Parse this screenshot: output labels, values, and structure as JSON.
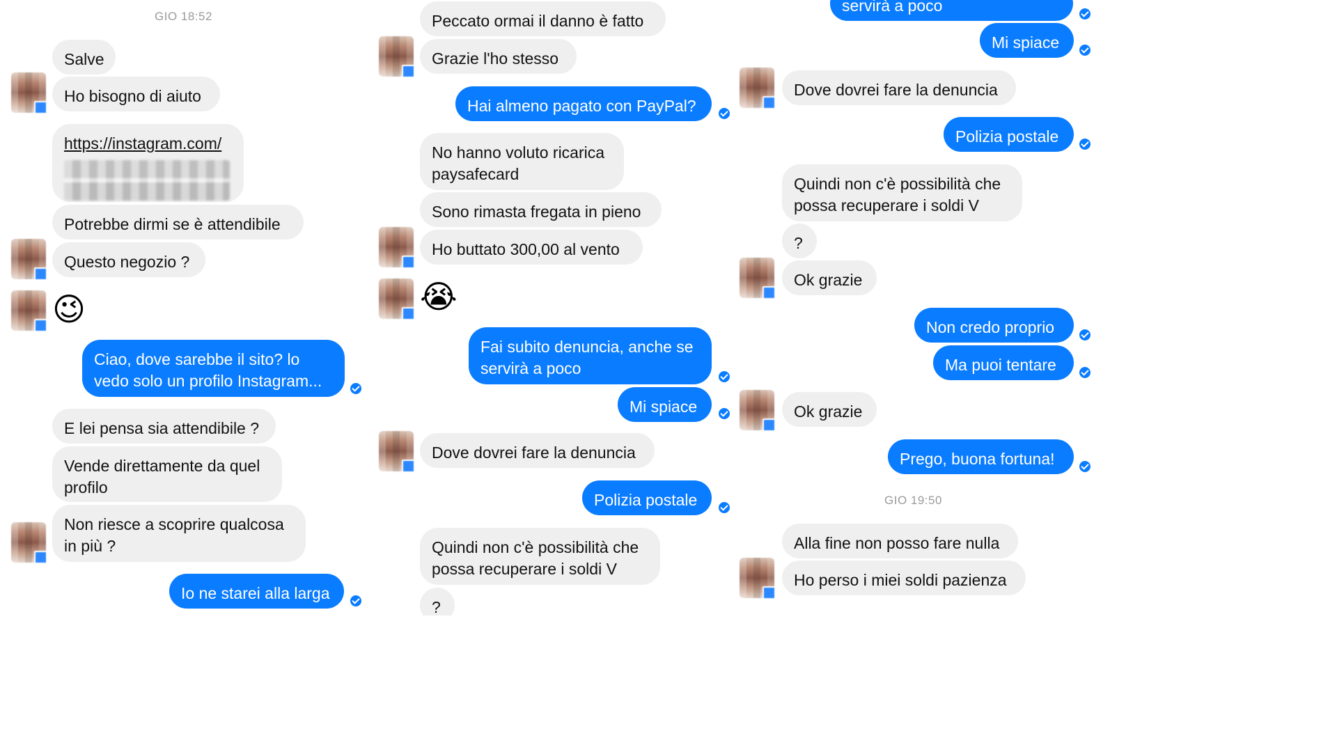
{
  "panels": [
    {
      "timestamp": "GIO 18:52",
      "messages": [
        {
          "dir": "in",
          "text": "Salve"
        },
        {
          "dir": "in",
          "text": "Ho bisogno di aiuto"
        },
        {
          "dir": "in",
          "text": "https://instagram.com/",
          "link": true
        },
        {
          "dir": "in",
          "text": "Potrebbe dirmi se è attendibile"
        },
        {
          "dir": "in",
          "text": "Questo negozio ?"
        },
        {
          "dir": "in",
          "emoji": "😉"
        },
        {
          "dir": "out",
          "text": "Ciao, dove sarebbe il sito? lo\nvedo solo un profilo Instagram..."
        },
        {
          "dir": "in",
          "text": "E lei pensa sia attendibile ?"
        },
        {
          "dir": "in",
          "text": "Vende direttamente da quel\nprofilo"
        },
        {
          "dir": "in",
          "text": "Non riesce a scoprire qualcosa\nin più ?"
        },
        {
          "dir": "out",
          "text": "Io ne starei alla larga"
        }
      ]
    },
    {
      "messages": [
        {
          "dir": "in",
          "text": "Peccato ormai il danno è fatto"
        },
        {
          "dir": "in",
          "text": "Grazie l'ho stesso"
        },
        {
          "dir": "out",
          "text": "Hai almeno pagato con PayPal?"
        },
        {
          "dir": "in",
          "text": "No hanno voluto ricarica\npaysafecard"
        },
        {
          "dir": "in",
          "text": "Sono rimasta fregata in pieno"
        },
        {
          "dir": "in",
          "text": "Ho buttato 300,00 al vento"
        },
        {
          "dir": "in",
          "emoji": "😭"
        },
        {
          "dir": "out",
          "text": "Fai subito denuncia, anche se\nservirà a poco"
        },
        {
          "dir": "out",
          "text": "Mi spiace"
        },
        {
          "dir": "in",
          "text": "Dove dovrei fare la denuncia"
        },
        {
          "dir": "out",
          "text": "Polizia postale"
        },
        {
          "dir": "in",
          "text": "Quindi non c'è possibilità che\npossa recuperare i soldi V"
        },
        {
          "dir": "in",
          "text": "?"
        }
      ]
    },
    {
      "messages": [
        {
          "dir": "out",
          "text": "servirà a poco"
        },
        {
          "dir": "out",
          "text": "Mi spiace"
        },
        {
          "dir": "in",
          "text": "Dove dovrei fare la denuncia"
        },
        {
          "dir": "out",
          "text": "Polizia postale"
        },
        {
          "dir": "in",
          "text": "Quindi non c'è possibilità che\npossa recuperare i soldi V"
        },
        {
          "dir": "in",
          "text": "?"
        },
        {
          "dir": "in",
          "text": "Ok grazie"
        },
        {
          "dir": "out",
          "text": "Non credo proprio"
        },
        {
          "dir": "out",
          "text": "Ma puoi tentare"
        },
        {
          "dir": "in",
          "text": "Ok grazie"
        },
        {
          "dir": "out",
          "text": "Prego, buona fortuna!"
        }
      ],
      "timestamp": "GIO 19:50",
      "messages_after": [
        {
          "dir": "in",
          "text": "Alla fine non posso fare nulla"
        },
        {
          "dir": "in",
          "text": "Ho perso i miei soldi pazienza"
        }
      ]
    }
  ],
  "colors": {
    "outgoing_bubble": "#0a7cff",
    "incoming_bubble": "#efeff0",
    "timestamp_text": "#9a9a9a",
    "background": "#ffffff"
  },
  "icons": {
    "read_receipt": "check-circle-icon",
    "avatar": "pixelated-avatar"
  }
}
